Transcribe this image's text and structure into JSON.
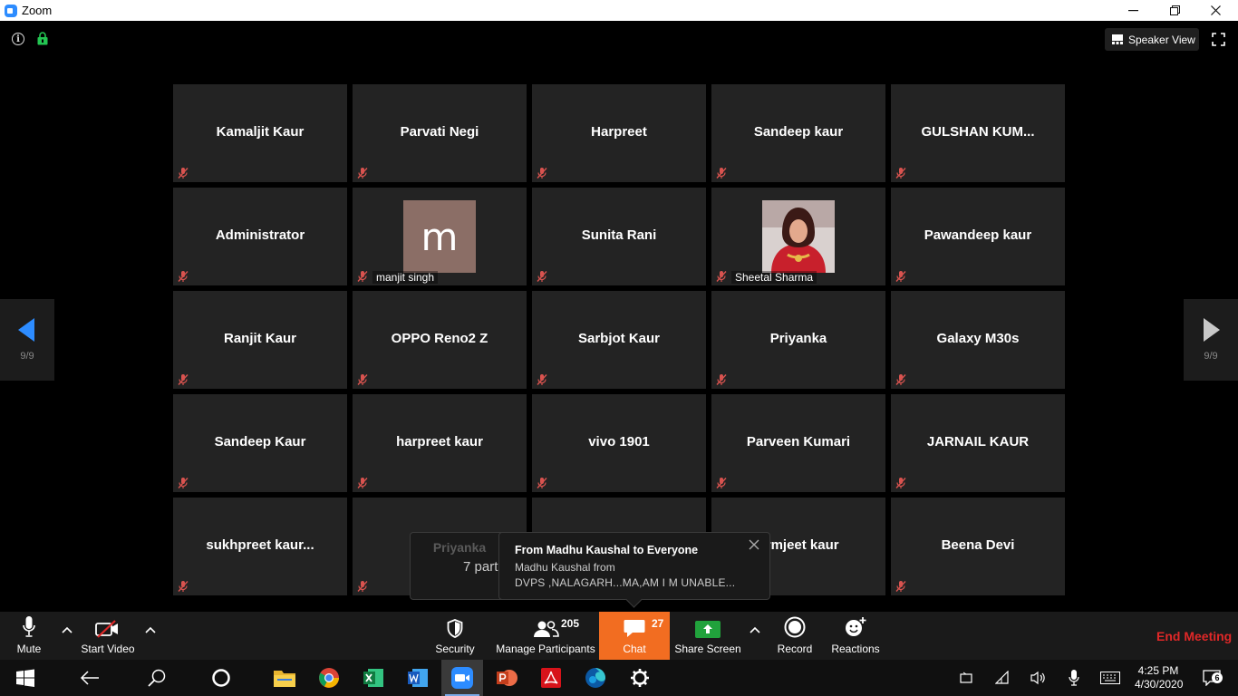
{
  "window": {
    "title": "Zoom"
  },
  "topbar": {
    "speaker_view_label": "Speaker View"
  },
  "paging": {
    "prev_count": "9/9",
    "next_count": "9/9"
  },
  "tiles": [
    [
      "Kamaljit Kaur",
      "Parvati Negi",
      "Harpreet",
      "Sandeep kaur",
      "GULSHAN  KUM..."
    ],
    [
      "Administrator",
      "manjit singh",
      "Sunita Rani",
      "Sheetal Sharma",
      "Pawandeep kaur"
    ],
    [
      "Ranjit Kaur",
      "OPPO Reno2 Z",
      "Sarbjot Kaur",
      "Priyanka",
      "Galaxy M30s"
    ],
    [
      "Sandeep Kaur",
      "harpreet kaur",
      "vivo 1901",
      "Parveen Kumari",
      "JARNAIL KAUR"
    ],
    [
      "sukhpreet  kaur...",
      "",
      "",
      "armjeet kaur",
      "Beena Devi"
    ]
  ],
  "avatar_letter": "m",
  "participant_popup": {
    "name": "Priyanka",
    "count_text": "7 part"
  },
  "chat_notification": {
    "from": "From Madhu Kaushal to Everyone",
    "line1": "Madhu Kaushal from",
    "line2": "DVPS ,NALAGARH...MA,AM I M UNABLE..."
  },
  "toolbar": {
    "mute_label": "Mute",
    "start_video_label": "Start Video",
    "security_label": "Security",
    "manage_participants_label": "Manage Participants",
    "participants_count": "205",
    "chat_label": "Chat",
    "chat_count": "27",
    "share_screen_label": "Share Screen",
    "record_label": "Record",
    "reactions_label": "Reactions",
    "end_meeting_label": "End Meeting"
  },
  "taskbar": {
    "time": "4:25 PM",
    "date": "4/30/2020",
    "notification_count": "6"
  },
  "colors": {
    "tile_bg": "#232323",
    "toolbar_bg": "#1a1a1a",
    "chat_accent": "#f26d21",
    "end_meeting": "#e02828",
    "share_green": "#21a23c",
    "nav_arrow": "#2d8cff",
    "mic_off_red": "#d9534f"
  }
}
